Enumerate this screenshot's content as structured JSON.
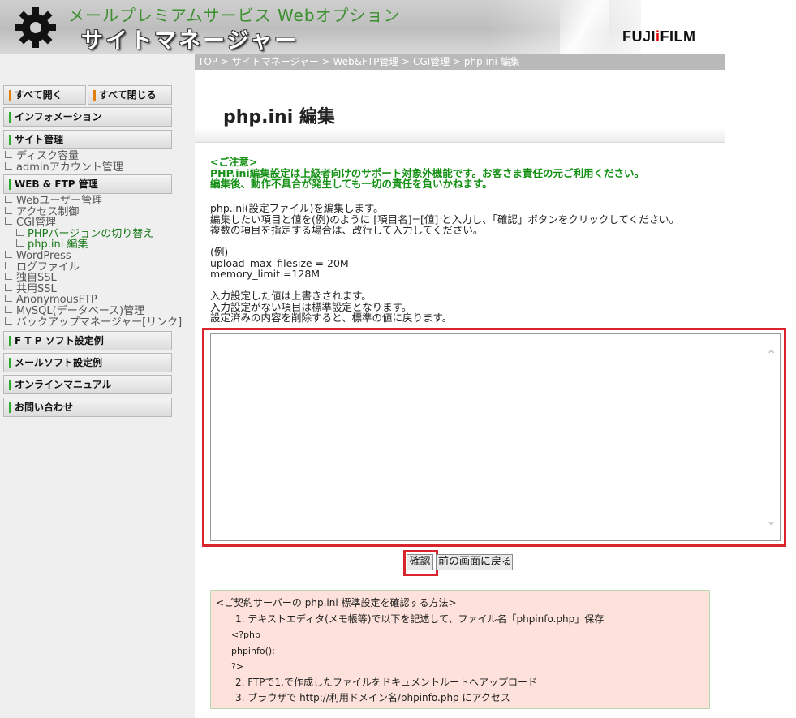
{
  "header": {
    "subtitle": "メールプレミアムサービス Webオプション",
    "title": "サイトマネージャー",
    "brand_a": "FUJI",
    "brand_dot": "i",
    "brand_b": "FILM"
  },
  "breadcrumb": "TOP > サイトマネージャー > Web&FTP管理 > CGI管理 > php.ini 編集",
  "sidebar": {
    "expand_all": "すべて開く",
    "collapse_all": "すべて閉じる",
    "information": "インフォメーション",
    "site_admin": "サイト管理",
    "site_items": [
      "ディスク容量",
      "adminアカウント管理"
    ],
    "web_ftp": "WEB & FTP 管理",
    "web_items_a": [
      "Webユーザー管理",
      "アクセス制御",
      "CGI管理"
    ],
    "cgi_items": [
      "PHPバージョンの切り替え",
      "php.ini 編集"
    ],
    "web_items_b": [
      "WordPress",
      "ログファイル",
      "独自SSL",
      "共用SSL",
      "AnonymousFTP",
      "MySQL(データベース)管理",
      "バックアップマネージャー[リンク]"
    ],
    "ftp_examples": "F T P ソフト設定例",
    "mail_examples": "メールソフト設定例",
    "manual": "オンラインマニュアル",
    "contact": "お問い合わせ"
  },
  "main": {
    "heading": "php.ini 編集",
    "notice": [
      "<ご注意>",
      "PHP.ini編集設定は上級者向けのサポート対象外機能です。お客さま責任の元ご利用ください。",
      "編集後、動作不具合が発生しても一切の責任を負いかねます。"
    ],
    "desc": [
      "php.ini(設定ファイル)を編集します。",
      "編集したい項目と値を(例)のように [項目名]=[値] と入力し、「確認」ボタンをクリックしてください。",
      "複数の項目を指定する場合は、改行して入力してください。"
    ],
    "example": [
      "(例)",
      "upload_max_filesize = 20M",
      "memory_limit =128M"
    ],
    "notes": [
      "入力設定した値は上書きされます。",
      "入力設定がない項目は標準設定となります。",
      "設定済みの内容を削除すると、標準の値に戻ります。"
    ],
    "editor_value": "",
    "confirm_label": "確認",
    "back_label": "前の画面に戻る",
    "info": {
      "title": "<ご契約サーバーの php.ini 標準設定を確認する方法>",
      "step1": "1. テキストエディタ(メモ帳等)で以下を記述して、ファイル名「phpinfo.php」保存",
      "code": [
        "<?php",
        "phpinfo();",
        "?>"
      ],
      "step2": "2. FTPで1.で作成したファイルをドキュメントルートへアップロード",
      "step3": "3. ブラウザで http://利用ドメイン名/phpinfo.php にアクセス"
    }
  }
}
